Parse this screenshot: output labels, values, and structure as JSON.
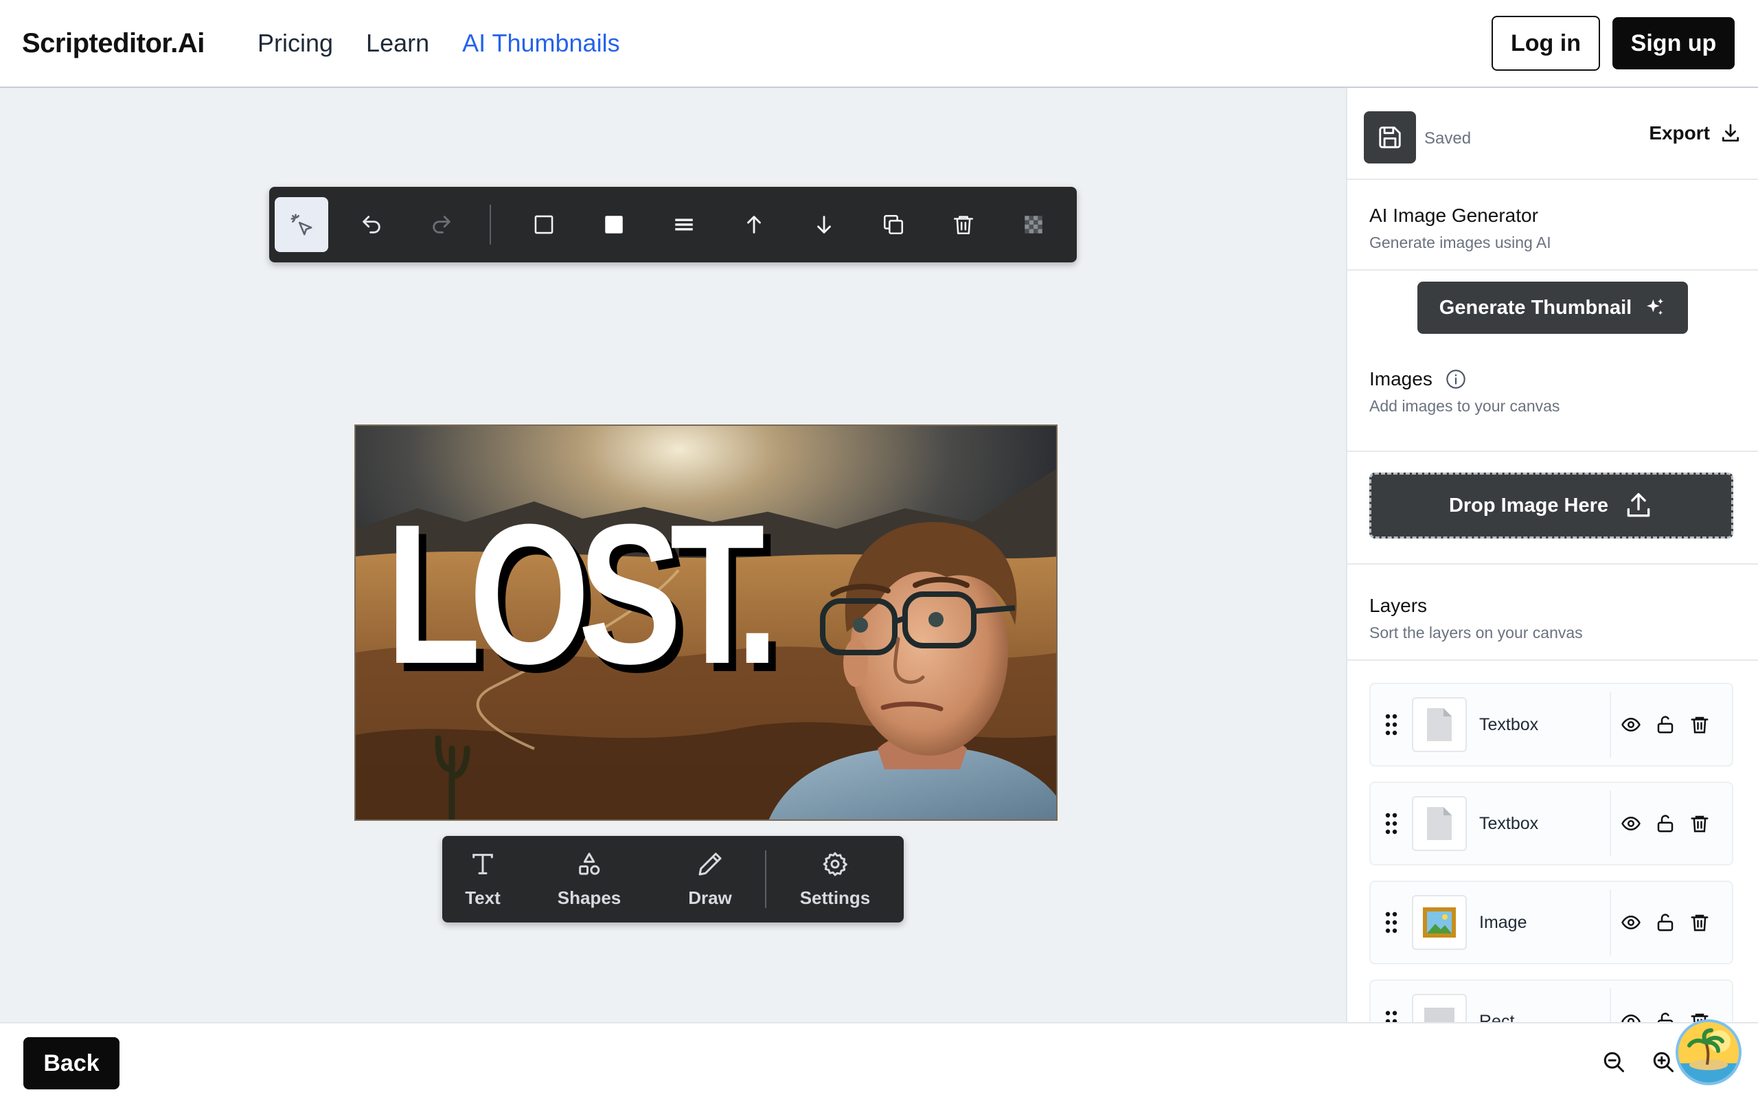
{
  "nav": {
    "brand": "Scripteditor.Ai",
    "links": [
      "Pricing",
      "Learn",
      "AI Thumbnails"
    ],
    "active_link": "AI Thumbnails",
    "login": "Log in",
    "signup": "Sign up"
  },
  "toolbar_top": {
    "tools": [
      "select-icon",
      "undo-icon",
      "redo-icon",
      "stroke-square-icon",
      "fill-square-icon",
      "align-lines-icon",
      "bring-forward-icon",
      "send-backward-icon",
      "duplicate-icon",
      "trash-icon",
      "transparency-icon"
    ]
  },
  "canvas": {
    "title_text": "LOST."
  },
  "toolbar_bottom": {
    "text": "Text",
    "shapes": "Shapes",
    "draw": "Draw",
    "settings": "Settings"
  },
  "panel": {
    "saved": "Saved",
    "export": "Export",
    "ai_title": "AI Image Generator",
    "ai_sub": "Generate images using AI",
    "generate": "Generate Thumbnail",
    "images_title": "Images",
    "images_sub": "Add images to your canvas",
    "drop": "Drop Image Here",
    "layers_title": "Layers",
    "layers_sub": "Sort the layers on your canvas",
    "layers": [
      {
        "name": "Textbox",
        "thumb": "textbox-thumb"
      },
      {
        "name": "Textbox",
        "thumb": "textbox-thumb"
      },
      {
        "name": "Image",
        "thumb": "image-thumb"
      },
      {
        "name": "Rect",
        "thumb": "rect-thumb"
      }
    ]
  },
  "bottom": {
    "back": "Back"
  },
  "colors": {
    "accent_link": "#2563eb",
    "dark_ui": "#27292b",
    "button_dark": "#3a3d40"
  }
}
